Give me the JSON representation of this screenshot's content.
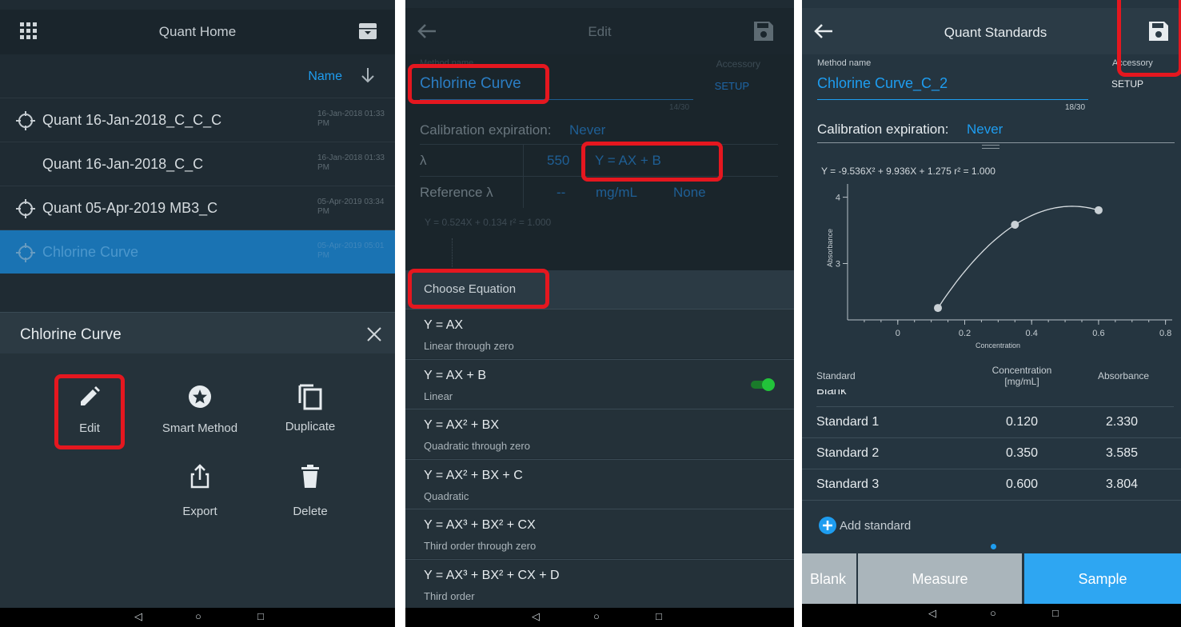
{
  "panel1": {
    "title": "Quant Home",
    "sort_label": "Name",
    "methods": [
      {
        "name": "Quant 16-Jan-2018_C_C_C",
        "date": "16-Jan-2018 01:33 PM"
      },
      {
        "name": "Quant 16-Jan-2018_C_C",
        "date": "16-Jan-2018 01:33 PM"
      },
      {
        "name": "Quant 05-Apr-2019 MB3_C",
        "date": "05-Apr-2019 03:34 PM"
      },
      {
        "name": "Chlorine Curve",
        "date": "05-Apr-2019 05:01 PM"
      }
    ],
    "sheet": {
      "title": "Chlorine Curve",
      "edit": "Edit",
      "smart": "Smart Method",
      "duplicate": "Duplicate",
      "export": "Export",
      "delete": "Delete"
    }
  },
  "panel2": {
    "title": "Edit",
    "method_label": "Method name",
    "accessory_label": "Accessory",
    "method_name": "Chlorine Curve",
    "accessory": "SETUP",
    "counter": "14/30",
    "cal_label": "Calibration expiration:",
    "cal_value": "Never",
    "lambda": "λ",
    "lambda_value": "550",
    "equation": "Y = AX + B",
    "ref_label": "Reference λ",
    "ref_value": "--",
    "unit": "mg/mL",
    "ref_none": "None",
    "fit": "Y = 0.524X + 0.134   r² = 1.000",
    "choose_title": "Choose Equation",
    "options": [
      {
        "eq": "Y = AX",
        "desc": "Linear through zero"
      },
      {
        "eq": "Y = AX + B",
        "desc": "Linear"
      },
      {
        "eq": "Y = AX² + BX",
        "desc": "Quadratic through zero"
      },
      {
        "eq": "Y = AX² + BX + C",
        "desc": "Quadratic"
      },
      {
        "eq": "Y = AX³ + BX² + CX",
        "desc": "Third order through zero"
      },
      {
        "eq": "Y = AX³ + BX² + CX + D",
        "desc": "Third order"
      }
    ]
  },
  "panel3": {
    "title": "Quant Standards",
    "method_label": "Method name",
    "accessory_label": "Accessory",
    "method_name": "Chlorine Curve_C_2",
    "accessory": "SETUP",
    "counter": "18/30",
    "cal_label": "Calibration expiration:",
    "cal_value": "Never",
    "fit": "Y = -9.536X² + 9.936X + 1.275   r² = 1.000",
    "table_headers": {
      "standard": "Standard",
      "concentration": "Concentration\n[mg/mL]",
      "absorbance": "Absorbance"
    },
    "partial_row": "Blank",
    "standards": [
      {
        "name": "Standard 1",
        "conc": "0.120",
        "abs": "2.330"
      },
      {
        "name": "Standard 2",
        "conc": "0.350",
        "abs": "3.585"
      },
      {
        "name": "Standard 3",
        "conc": "0.600",
        "abs": "3.804"
      }
    ],
    "add_standard": "Add standard",
    "btn_blank": "Blank",
    "btn_measure": "Measure",
    "btn_sample": "Sample"
  },
  "colors": {
    "accent": "#1e9df0",
    "highlight": "#e5171f",
    "selected_row": "#1a73b3",
    "toggle": "#22c33a"
  },
  "chart_data": {
    "type": "scatter",
    "xlabel": "Concentration",
    "ylabel": "Absorbance",
    "x_ticks": [
      "0",
      "0.2",
      "0.4",
      "0.6",
      "0.8"
    ],
    "y_ticks": [
      "3",
      "4"
    ],
    "xlim": [
      -0.15,
      0.82
    ],
    "ylim": [
      2.15,
      4.2
    ],
    "points": [
      {
        "x": 0.12,
        "y": 2.33
      },
      {
        "x": 0.35,
        "y": 3.585
      },
      {
        "x": 0.6,
        "y": 3.804
      }
    ],
    "fit": {
      "a": -9.536,
      "b": 9.936,
      "c": 1.275
    }
  }
}
